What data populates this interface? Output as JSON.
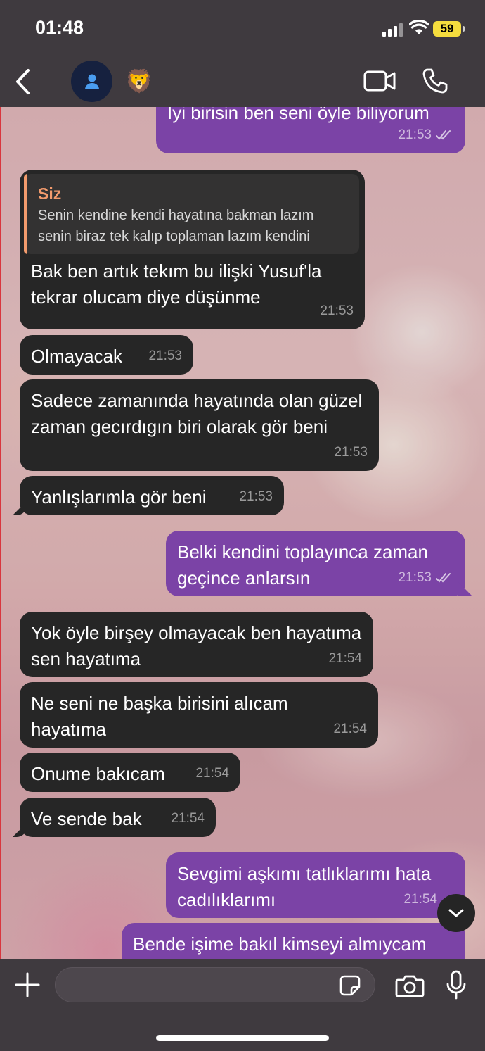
{
  "status_bar": {
    "time": "01:48",
    "battery": "59"
  },
  "header": {
    "contact_emoji": "🦁"
  },
  "messages": [
    {
      "dir": "out",
      "text": "Iyi birisin ben seni öyle biliyorum",
      "time": "21:53"
    },
    {
      "dir": "in",
      "quote_author": "Siz",
      "quote_text": "Senin kendine kendi hayatına bakman lazım senin biraz tek kalıp toplaman lazım kendini",
      "text": "Bak ben artık tekım bu ilişki Yusuf'la tekrar olucam diye düşünme",
      "time": "21:53"
    },
    {
      "dir": "in",
      "text": "Olmayacak",
      "time": "21:53"
    },
    {
      "dir": "in",
      "text": "Sadece zamanında hayatında olan güzel zaman gecırdıgın biri olarak gör beni",
      "time": "21:53"
    },
    {
      "dir": "in",
      "text": "Yanlışlarımla gör beni",
      "time": "21:53"
    },
    {
      "dir": "out",
      "text": "Belki kendini toplayınca zaman geçince anlarsın",
      "time": "21:53"
    },
    {
      "dir": "in",
      "text": "Yok öyle birşey olmayacak ben hayatıma sen hayatıma",
      "time": "21:54"
    },
    {
      "dir": "in",
      "text": "Ne seni ne başka birisini alıcam hayatıma",
      "time": "21:54"
    },
    {
      "dir": "in",
      "text": "Onume bakıcam",
      "time": "21:54"
    },
    {
      "dir": "in",
      "text": "Ve sende bak",
      "time": "21:54"
    },
    {
      "dir": "out",
      "text": "Sevgimi aşkımı tatlıklarımı hata cadılıklarımı",
      "time": "21:54"
    },
    {
      "dir": "out",
      "text": "Bende işime bakıl kimseyi almıycam",
      "time": ""
    }
  ],
  "input": {
    "placeholder": ""
  },
  "colors": {
    "incoming": "#262626",
    "outgoing": "#7b43a6",
    "quote_accent": "#f39b6d"
  },
  "icons": [
    "back-icon",
    "contact-avatar-icon",
    "video-call-icon",
    "phone-call-icon",
    "plus-icon",
    "sticker-icon",
    "camera-icon",
    "microphone-icon",
    "chevron-down-icon"
  ]
}
